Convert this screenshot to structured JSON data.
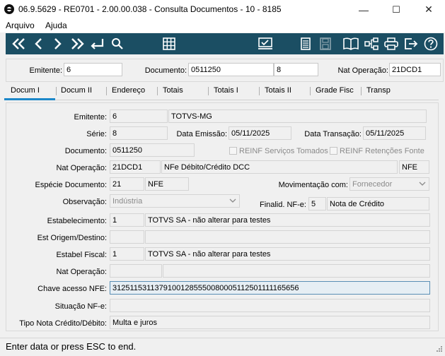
{
  "window": {
    "title": "06.9.5629 - RE0701 - 2.00.00.038 - Consulta Documentos - 10 - 8185",
    "minimize": "—",
    "maximize": "☐",
    "close": "✕"
  },
  "menu": {
    "arquivo": "Arquivo",
    "ajuda": "Ajuda"
  },
  "toolbar": {
    "icons": [
      "first-icon",
      "prev-icon",
      "next-icon",
      "last-icon",
      "return-icon",
      "search-icon",
      "grid-icon",
      "check-icon",
      "list-icon",
      "save-icon",
      "book-icon",
      "tree-icon",
      "print-icon",
      "exit-icon",
      "help-icon"
    ]
  },
  "header": {
    "emitente_label": "Emitente:",
    "emitente_value": "6",
    "documento_label": "Documento:",
    "documento_value": "0511250",
    "serie_value": "8",
    "nat_label": "Nat Operação:",
    "nat_value": "21DCD1"
  },
  "tabs": [
    "Docum I",
    "Docum II",
    "Endereço",
    "Totais",
    "Totais I",
    "Totais II",
    "Grade Fisc",
    "Transp"
  ],
  "form": {
    "emitente_label": "Emitente:",
    "emitente_code": "6",
    "emitente_name": "TOTVS-MG",
    "serie_label": "Série:",
    "serie_value": "8",
    "data_emissao_label": "Data Emissão:",
    "data_emissao_value": "05/11/2025",
    "data_transacao_label": "Data Transação:",
    "data_transacao_value": "05/11/2025",
    "documento_label": "Documento:",
    "documento_value": "0511250",
    "reinf_servicos": "REINF Serviços Tomados",
    "reinf_retencoes": "REINF Retenções Fonte",
    "nat_operacao_label": "Nat Operação:",
    "nat_operacao_code": "21DCD1",
    "nat_operacao_desc": "NFe Débito/Crédito DCC",
    "nat_operacao_type": "NFE",
    "especie_label": "Espécie Documento:",
    "especie_code": "21",
    "especie_desc": "NFE",
    "movimentacao_label": "Movimentação com:",
    "movimentacao_value": "Fornecedor",
    "observacao_label": "Observação:",
    "observacao_value": "Indústria",
    "finalid_label": "Finalid. NF-e:",
    "finalid_code": "5",
    "finalid_desc": "Nota de Crédito",
    "estab_label": "Estabelecimento:",
    "estab_code": "1",
    "estab_desc": "TOTVS SA - não alterar para testes",
    "est_origem_label": "Est Origem/Destino:",
    "estab_fiscal_label": "Estabel Fiscal:",
    "estab_fiscal_code": "1",
    "estab_fiscal_desc": "TOTVS SA - não alterar para testes",
    "nat_op2_label": "Nat Operação:",
    "chave_label": "Chave acesso NFE:",
    "chave_value": "31251153113791001285550080005112501111165656",
    "situacao_label": "Situação NF-e:",
    "tipo_nota_label": "Tipo Nota Crédito/Débito:",
    "tipo_nota_value": "Multa e juros"
  },
  "status": {
    "text": "Enter data or press ESC to end."
  }
}
